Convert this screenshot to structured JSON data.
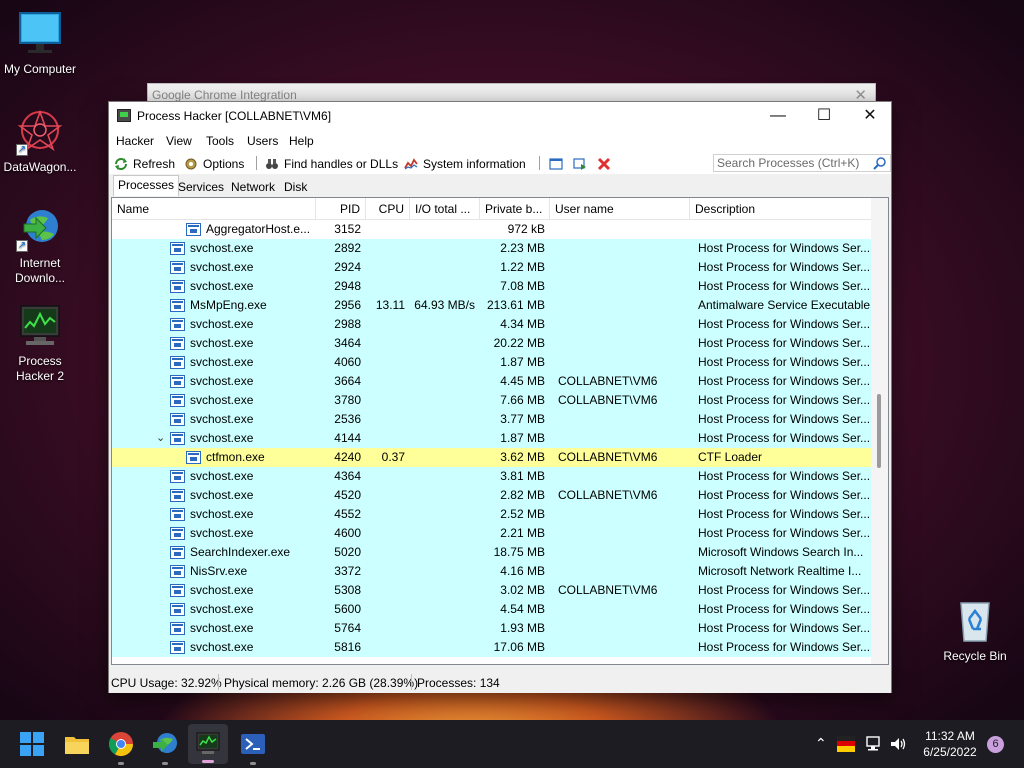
{
  "desktop": {
    "icons": [
      {
        "label": "My Computer"
      },
      {
        "label": "DataWagon..."
      },
      {
        "label": "Internet Downlo..."
      },
      {
        "label": "Process Hacker 2"
      },
      {
        "label": "Recycle Bin"
      }
    ]
  },
  "background_window": {
    "title": "Google Chrome Integration"
  },
  "window": {
    "title": "Process Hacker [COLLABNET\\VM6]",
    "menu": [
      "Hacker",
      "View",
      "Tools",
      "Users",
      "Help"
    ],
    "toolbar": {
      "refresh": "Refresh",
      "options": "Options",
      "find_handles": "Find handles or DLLs",
      "system_info": "System information",
      "search_placeholder": "Search Processes (Ctrl+K)"
    },
    "tabs": [
      "Processes",
      "Services",
      "Network",
      "Disk"
    ],
    "columns": [
      "Name",
      "PID",
      "CPU",
      "I/O total ...",
      "Private b...",
      "User name",
      "Description"
    ],
    "rows": [
      {
        "name": "AggregatorHost.e...",
        "pid": "3152",
        "cpu": "",
        "io": "",
        "priv": "972 kB",
        "user": "",
        "desc": ""
      },
      {
        "name": "svchost.exe",
        "pid": "2892",
        "cpu": "",
        "io": "",
        "priv": "2.23 MB",
        "user": "",
        "desc": "Host Process for Windows Ser..."
      },
      {
        "name": "svchost.exe",
        "pid": "2924",
        "cpu": "",
        "io": "",
        "priv": "1.22 MB",
        "user": "",
        "desc": "Host Process for Windows Ser..."
      },
      {
        "name": "svchost.exe",
        "pid": "2948",
        "cpu": "",
        "io": "",
        "priv": "7.08 MB",
        "user": "",
        "desc": "Host Process for Windows Ser..."
      },
      {
        "name": "MsMpEng.exe",
        "pid": "2956",
        "cpu": "13.11",
        "io": "64.93 MB/s",
        "priv": "213.61 MB",
        "user": "",
        "desc": "Antimalware Service Executable"
      },
      {
        "name": "svchost.exe",
        "pid": "2988",
        "cpu": "",
        "io": "",
        "priv": "4.34 MB",
        "user": "",
        "desc": "Host Process for Windows Ser..."
      },
      {
        "name": "svchost.exe",
        "pid": "3464",
        "cpu": "",
        "io": "",
        "priv": "20.22 MB",
        "user": "",
        "desc": "Host Process for Windows Ser..."
      },
      {
        "name": "svchost.exe",
        "pid": "4060",
        "cpu": "",
        "io": "",
        "priv": "1.87 MB",
        "user": "",
        "desc": "Host Process for Windows Ser..."
      },
      {
        "name": "svchost.exe",
        "pid": "3664",
        "cpu": "",
        "io": "",
        "priv": "4.45 MB",
        "user": "COLLABNET\\VM6",
        "desc": "Host Process for Windows Ser..."
      },
      {
        "name": "svchost.exe",
        "pid": "3780",
        "cpu": "",
        "io": "",
        "priv": "7.66 MB",
        "user": "COLLABNET\\VM6",
        "desc": "Host Process for Windows Ser..."
      },
      {
        "name": "svchost.exe",
        "pid": "2536",
        "cpu": "",
        "io": "",
        "priv": "3.77 MB",
        "user": "",
        "desc": "Host Process for Windows Ser..."
      },
      {
        "name": "svchost.exe",
        "pid": "4144",
        "cpu": "",
        "io": "",
        "priv": "1.87 MB",
        "user": "",
        "desc": "Host Process for Windows Ser..."
      },
      {
        "name": "ctfmon.exe",
        "pid": "4240",
        "cpu": "0.37",
        "io": "",
        "priv": "3.62 MB",
        "user": "COLLABNET\\VM6",
        "desc": "CTF Loader"
      },
      {
        "name": "svchost.exe",
        "pid": "4364",
        "cpu": "",
        "io": "",
        "priv": "3.81 MB",
        "user": "",
        "desc": "Host Process for Windows Ser..."
      },
      {
        "name": "svchost.exe",
        "pid": "4520",
        "cpu": "",
        "io": "",
        "priv": "2.82 MB",
        "user": "COLLABNET\\VM6",
        "desc": "Host Process for Windows Ser..."
      },
      {
        "name": "svchost.exe",
        "pid": "4552",
        "cpu": "",
        "io": "",
        "priv": "2.52 MB",
        "user": "",
        "desc": "Host Process for Windows Ser..."
      },
      {
        "name": "svchost.exe",
        "pid": "4600",
        "cpu": "",
        "io": "",
        "priv": "2.21 MB",
        "user": "",
        "desc": "Host Process for Windows Ser..."
      },
      {
        "name": "SearchIndexer.exe",
        "pid": "5020",
        "cpu": "",
        "io": "",
        "priv": "18.75 MB",
        "user": "",
        "desc": "Microsoft Windows Search In..."
      },
      {
        "name": "NisSrv.exe",
        "pid": "3372",
        "cpu": "",
        "io": "",
        "priv": "4.16 MB",
        "user": "",
        "desc": "Microsoft Network Realtime I..."
      },
      {
        "name": "svchost.exe",
        "pid": "5308",
        "cpu": "",
        "io": "",
        "priv": "3.02 MB",
        "user": "COLLABNET\\VM6",
        "desc": "Host Process for Windows Ser..."
      },
      {
        "name": "svchost.exe",
        "pid": "5600",
        "cpu": "",
        "io": "",
        "priv": "4.54 MB",
        "user": "",
        "desc": "Host Process for Windows Ser..."
      },
      {
        "name": "svchost.exe",
        "pid": "5764",
        "cpu": "",
        "io": "",
        "priv": "1.93 MB",
        "user": "",
        "desc": "Host Process for Windows Ser..."
      },
      {
        "name": "svchost.exe",
        "pid": "5816",
        "cpu": "",
        "io": "",
        "priv": "17.06 MB",
        "user": "",
        "desc": "Host Process for Windows Ser..."
      }
    ],
    "status": {
      "cpu": "CPU Usage: 32.92%",
      "memory": "Physical memory: 2.26 GB (28.39%)",
      "processes": "Processes: 134"
    }
  },
  "taskbar": {
    "time": "11:32 AM",
    "date": "6/25/2022",
    "notifications": "6"
  },
  "colors": {
    "service_row": "#ccffff",
    "highlight_row": "#ffff99"
  }
}
